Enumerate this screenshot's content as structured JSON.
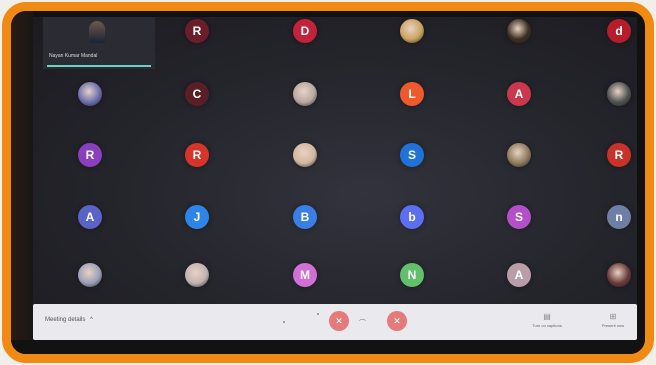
{
  "meeting": {
    "self_tile_name": "Nayan Kumar Mandal",
    "details_label": "Meeting details",
    "details_chevron": "^"
  },
  "participants": [
    {
      "initial": "",
      "color": "#4b5a8a"
    },
    {
      "initial": "R",
      "color": "#6b1e2a"
    },
    {
      "initial": "D",
      "color": "#c2233a"
    },
    {
      "initial": "",
      "color": "#caa35e"
    },
    {
      "initial": "",
      "color": "#3b3020"
    },
    {
      "initial": "d",
      "color": "#b51d2a"
    },
    {
      "initial": "",
      "color": "#6b6fae"
    },
    {
      "initial": "C",
      "color": "#5a1e26"
    },
    {
      "initial": "",
      "color": "#b8a8a2"
    },
    {
      "initial": "L",
      "color": "#ef5a2c"
    },
    {
      "initial": "A",
      "color": "#c9384d"
    },
    {
      "initial": "",
      "color": "#505252"
    },
    {
      "initial": "R",
      "color": "#8a3fbf"
    },
    {
      "initial": "R",
      "color": "#d8352a"
    },
    {
      "initial": "",
      "color": "#d3b69f"
    },
    {
      "initial": "S",
      "color": "#1f73d8"
    },
    {
      "initial": "",
      "color": "#8e7a5c"
    },
    {
      "initial": "R",
      "color": "#c8322a"
    },
    {
      "initial": "A",
      "color": "#5a63c7"
    },
    {
      "initial": "J",
      "color": "#2f84ea"
    },
    {
      "initial": "B",
      "color": "#3a7fe6"
    },
    {
      "initial": "b",
      "color": "#5b6ff0"
    },
    {
      "initial": "S",
      "color": "#b34fc9"
    },
    {
      "initial": "n",
      "color": "#6e7fa6"
    },
    {
      "initial": "",
      "color": "#9aa0b8"
    },
    {
      "initial": "",
      "color": "#c0b4b0"
    },
    {
      "initial": "M",
      "color": "#d070d6"
    },
    {
      "initial": "N",
      "color": "#62c06a"
    },
    {
      "initial": "A",
      "color": "#b99ea8"
    },
    {
      "initial": "",
      "color": "#6a3a3a"
    }
  ],
  "controls": {
    "mic_icon": "mic-off-icon",
    "camera_icon": "camera-off-icon",
    "hangup_glyph": "⌒",
    "captions_icon": "captions-icon",
    "captions_label": "Turn on captions",
    "present_icon": "present-icon",
    "present_label": "Present now",
    "accent_danger": "#e47a7a",
    "frame_color": "#f08a12"
  }
}
